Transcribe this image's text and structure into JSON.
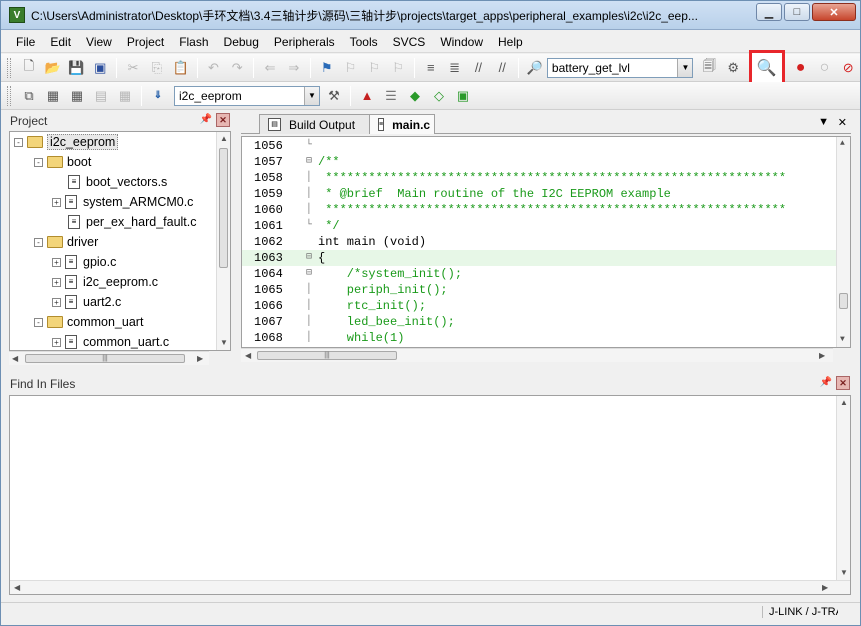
{
  "window": {
    "title": "C:\\Users\\Administrator\\Desktop\\手环文档\\3.4三轴计步\\源码\\三轴计步\\projects\\target_apps\\peripheral_examples\\i2c\\i2c_eep...",
    "app_icon": "keil-uvision-icon"
  },
  "menu": [
    "File",
    "Edit",
    "View",
    "Project",
    "Flash",
    "Debug",
    "Peripherals",
    "Tools",
    "SVCS",
    "Window",
    "Help"
  ],
  "toolbar1": {
    "find_combo_value": "battery_get_lvl"
  },
  "toolbar2": {
    "target_combo_value": "i2c_eeprom"
  },
  "project_panel": {
    "title": "Project",
    "tree": [
      {
        "label": "i2c_eeprom",
        "type": "root",
        "expander": "-"
      },
      {
        "label": "boot",
        "type": "folder",
        "expander": "-"
      },
      {
        "label": "boot_vectors.s",
        "type": "file",
        "expander": ""
      },
      {
        "label": "system_ARMCM0.c",
        "type": "file",
        "expander": "+"
      },
      {
        "label": "per_ex_hard_fault.c",
        "type": "file",
        "expander": ""
      },
      {
        "label": "driver",
        "type": "folder",
        "expander": "-"
      },
      {
        "label": "gpio.c",
        "type": "file",
        "expander": "+"
      },
      {
        "label": "i2c_eeprom.c",
        "type": "file",
        "expander": "+"
      },
      {
        "label": "uart2.c",
        "type": "file",
        "expander": "+"
      },
      {
        "label": "common_uart",
        "type": "folder",
        "expander": "-"
      },
      {
        "label": "common_uart.c",
        "type": "file",
        "expander": "+"
      }
    ]
  },
  "editor": {
    "tabs": [
      {
        "label": "Build Output",
        "active": false
      },
      {
        "label": "main.c",
        "active": true
      }
    ],
    "lines": [
      {
        "num": "1056",
        "fold": "└",
        "text": "",
        "style": "plain",
        "current": false
      },
      {
        "num": "1057",
        "fold": "⊟",
        "text": "/**",
        "style": "comment",
        "current": false
      },
      {
        "num": "1058",
        "fold": "│",
        "text": " ****************************************************************",
        "style": "comment",
        "current": false
      },
      {
        "num": "1059",
        "fold": "│",
        "text": " * @brief  Main routine of the I2C EEPROM example",
        "style": "comment",
        "current": false
      },
      {
        "num": "1060",
        "fold": "│",
        "text": " ****************************************************************",
        "style": "comment",
        "current": false
      },
      {
        "num": "1061",
        "fold": "└",
        "text": " */",
        "style": "comment",
        "current": false
      },
      {
        "num": "1062",
        "fold": "",
        "text": "int main (void)",
        "style": "plain",
        "current": false
      },
      {
        "num": "1063",
        "fold": "⊟",
        "text": "{",
        "style": "plain",
        "current": true
      },
      {
        "num": "1064",
        "fold": "⊟",
        "text": "    /*system_init();",
        "style": "comment",
        "current": false
      },
      {
        "num": "1065",
        "fold": "│",
        "text": "    periph_init();",
        "style": "code",
        "current": false
      },
      {
        "num": "1066",
        "fold": "│",
        "text": "    rtc_init();",
        "style": "code",
        "current": false
      },
      {
        "num": "1067",
        "fold": "│",
        "text": "    led_bee_init();",
        "style": "code",
        "current": false
      },
      {
        "num": "1068",
        "fold": "│",
        "text": "    while(1)",
        "style": "code",
        "current": false
      }
    ]
  },
  "find_panel": {
    "title": "Find In Files"
  },
  "status": {
    "debugger": "J-LINK / J-TRACE Cortex"
  },
  "colors": {
    "highlight_box": "#e8262b",
    "comment": "#1a9a1a",
    "current_line": "#e7f7e7"
  }
}
